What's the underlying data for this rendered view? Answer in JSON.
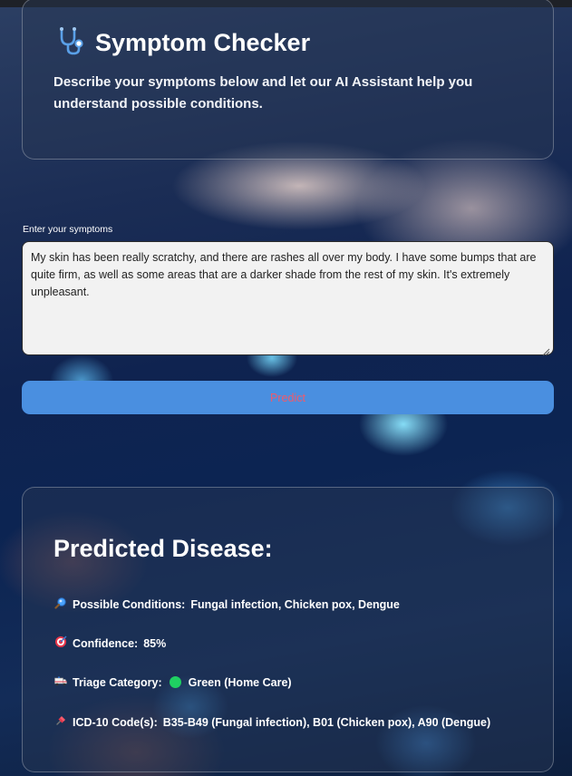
{
  "header": {
    "title": "Symptom Checker",
    "title_icon": "stethoscope-icon",
    "subtitle": "Describe your symptoms below and let our AI Assistant help you understand possible conditions."
  },
  "form": {
    "label": "Enter your symptoms",
    "value": "My skin has been really scratchy, and there are rashes all over my body. I have some bumps that are quite firm, as well as some areas that are a darker shade from the rest of my skin. It's extremely unpleasant.",
    "button_label": "Predict"
  },
  "result": {
    "title": "Predicted Disease:",
    "conditions": {
      "icon": "magnifier-icon",
      "label": "Possible Conditions:",
      "value": "Fungal infection, Chicken pox, Dengue"
    },
    "confidence": {
      "icon": "target-icon",
      "label": "Confidence:",
      "value": "85%"
    },
    "triage": {
      "icon": "ambulance-icon",
      "label": "Triage Category:",
      "status_color": "#1fcf62",
      "value": "Green (Home Care)"
    },
    "icd": {
      "icon": "pushpin-icon",
      "label": "ICD-10 Code(s):",
      "value": "B35-B49 (Fungal infection), B01 (Chicken pox), A90 (Dengue)"
    }
  },
  "colors": {
    "button_bg": "#4a8fe0",
    "button_text": "#f05a6a",
    "input_bg": "#f2f2f2"
  }
}
